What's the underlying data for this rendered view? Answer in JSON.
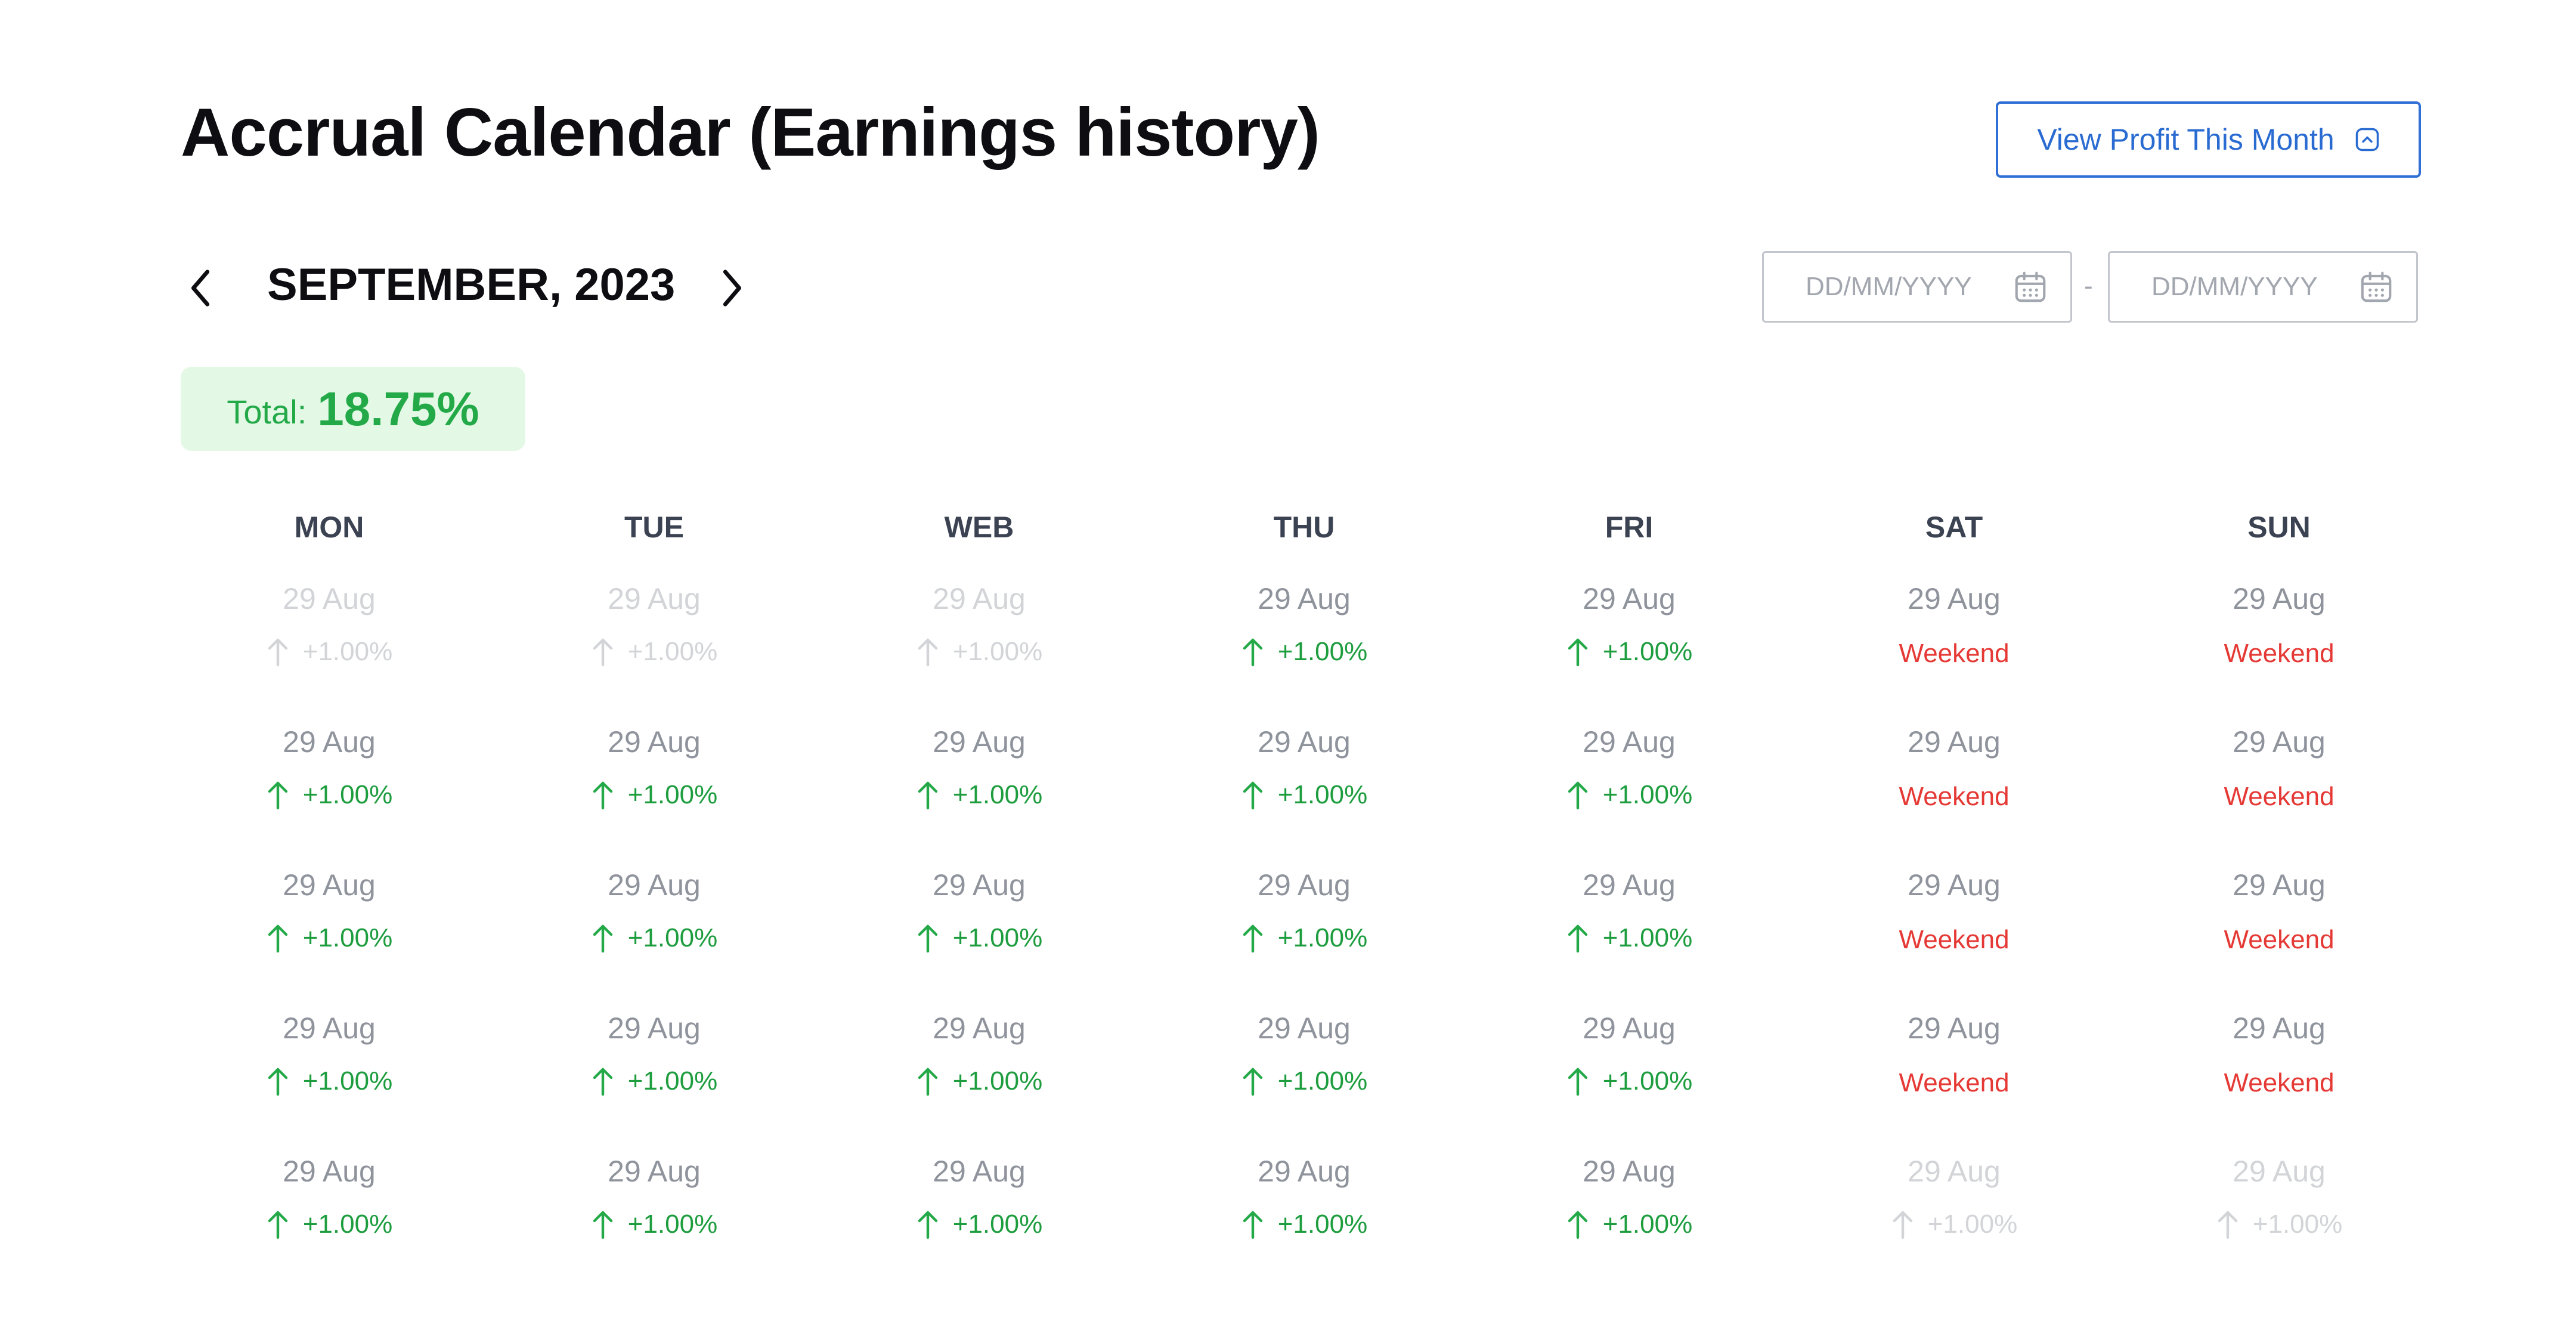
{
  "header": {
    "title": "Accrual Calendar (Earnings history)",
    "profit_button_label": "View Profit This Month"
  },
  "nav": {
    "month_label": "SEPTEMBER, 2023"
  },
  "range": {
    "from_placeholder": "DD/MM/YYYY",
    "to_placeholder": "DD/MM/YYYY",
    "separator": "-"
  },
  "total": {
    "label": "Total:",
    "value": "18.75%"
  },
  "weekdays": [
    "MON",
    "TUE",
    "WEB",
    "THU",
    "FRI",
    "SAT",
    "SUN"
  ],
  "colors": {
    "accent": "#2a6bd1",
    "positive": "#23a947",
    "weekend": "#e53935",
    "muted": "#d2d4d8"
  },
  "weeks": [
    [
      {
        "date": "29 Aug",
        "change": "+1.00%",
        "muted": true
      },
      {
        "date": "29 Aug",
        "change": "+1.00%",
        "muted": true
      },
      {
        "date": "29 Aug",
        "change": "+1.00%",
        "muted": true
      },
      {
        "date": "29 Aug",
        "change": "+1.00%"
      },
      {
        "date": "29 Aug",
        "change": "+1.00%"
      },
      {
        "date": "29 Aug",
        "note": "Weekend"
      },
      {
        "date": "29 Aug",
        "note": "Weekend"
      }
    ],
    [
      {
        "date": "29 Aug",
        "change": "+1.00%"
      },
      {
        "date": "29 Aug",
        "change": "+1.00%"
      },
      {
        "date": "29 Aug",
        "change": "+1.00%"
      },
      {
        "date": "29 Aug",
        "change": "+1.00%"
      },
      {
        "date": "29 Aug",
        "change": "+1.00%"
      },
      {
        "date": "29 Aug",
        "note": "Weekend"
      },
      {
        "date": "29 Aug",
        "note": "Weekend"
      }
    ],
    [
      {
        "date": "29 Aug",
        "change": "+1.00%"
      },
      {
        "date": "29 Aug",
        "change": "+1.00%"
      },
      {
        "date": "29 Aug",
        "change": "+1.00%"
      },
      {
        "date": "29 Aug",
        "change": "+1.00%"
      },
      {
        "date": "29 Aug",
        "change": "+1.00%"
      },
      {
        "date": "29 Aug",
        "note": "Weekend"
      },
      {
        "date": "29 Aug",
        "note": "Weekend"
      }
    ],
    [
      {
        "date": "29 Aug",
        "change": "+1.00%"
      },
      {
        "date": "29 Aug",
        "change": "+1.00%"
      },
      {
        "date": "29 Aug",
        "change": "+1.00%"
      },
      {
        "date": "29 Aug",
        "change": "+1.00%"
      },
      {
        "date": "29 Aug",
        "change": "+1.00%"
      },
      {
        "date": "29 Aug",
        "note": "Weekend"
      },
      {
        "date": "29 Aug",
        "note": "Weekend"
      }
    ],
    [
      {
        "date": "29 Aug",
        "change": "+1.00%"
      },
      {
        "date": "29 Aug",
        "change": "+1.00%"
      },
      {
        "date": "29 Aug",
        "change": "+1.00%"
      },
      {
        "date": "29 Aug",
        "change": "+1.00%"
      },
      {
        "date": "29 Aug",
        "change": "+1.00%"
      },
      {
        "date": "29 Aug",
        "change": "+1.00%",
        "muted": true
      },
      {
        "date": "29 Aug",
        "change": "+1.00%",
        "muted": true
      }
    ]
  ]
}
